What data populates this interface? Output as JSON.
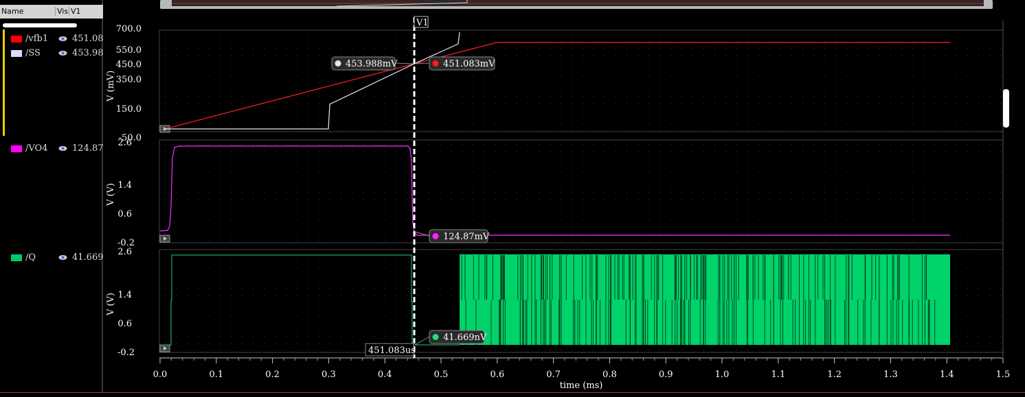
{
  "legend": {
    "headers": {
      "name": "Name",
      "vis": "Vis",
      "v1": "V1"
    },
    "signals": [
      {
        "name": "/vfb1",
        "value": "451.08",
        "color": "#ff0000"
      },
      {
        "name": "/SS",
        "value": "453.98",
        "color": "#d8dcff"
      },
      {
        "name": "/VO4",
        "value": "124.87",
        "color": "#ff00ff"
      },
      {
        "name": "/Q",
        "value": "41.669",
        "color": "#00cc66"
      }
    ]
  },
  "cursor": {
    "label": "V1",
    "time_label": "451.083us"
  },
  "markers": {
    "ss": "453.988mV",
    "vfb1": "451.083mV",
    "vo4": "124.87mV",
    "q": "41.669nV"
  },
  "panels": [
    {
      "ylabel": "V (mV)",
      "ticks": [
        "700.0",
        "550.0",
        "450.0",
        "350.0",
        "150.0",
        "-50.0"
      ]
    },
    {
      "ylabel": "V (V)",
      "ticks": [
        "2.6",
        "1.4",
        "0.6",
        "-0.2"
      ]
    },
    {
      "ylabel": "V (V)",
      "ticks": [
        "2.6",
        "1.4",
        "0.6",
        "-0.2"
      ]
    }
  ],
  "xaxis": {
    "label": "time (ms)",
    "ticks": [
      "0.0",
      "0.1",
      "0.2",
      "0.3",
      "0.4",
      "0.5",
      "0.6",
      "0.7",
      "0.8",
      "0.9",
      "1.0",
      "1.1",
      "1.2",
      "1.3",
      "1.4",
      "1.5"
    ]
  },
  "chart_data": [
    {
      "type": "line",
      "ylabel": "V (mV)",
      "series": [
        {
          "name": "/vfb1",
          "x": [
            0.0,
            0.45,
            0.6,
            1.407
          ],
          "y": [
            -50,
            451,
            610,
            610
          ]
        },
        {
          "name": "/SS",
          "x": [
            0.0,
            0.3,
            0.3,
            0.451,
            0.53,
            0.53
          ],
          "y": [
            -50,
            -50,
            170,
            454,
            580,
            640
          ]
        }
      ]
    },
    {
      "type": "line",
      "ylabel": "V (V)",
      "series": [
        {
          "name": "/VO4",
          "x": [
            0.0,
            0.02,
            0.025,
            0.44,
            0.45,
            0.46,
            1.407
          ],
          "y": [
            0.0,
            0.2,
            2.4,
            2.4,
            0.8,
            0.125,
            0.125
          ]
        }
      ]
    },
    {
      "type": "line",
      "ylabel": "V (V)",
      "series": [
        {
          "name": "/Q",
          "x": [
            0.0,
            0.02,
            0.021,
            0.45,
            0.451,
            0.535,
            1.407
          ],
          "y": [
            0.0,
            0.0,
            2.5,
            2.5,
            0.0,
            0.0,
            2.5
          ]
        }
      ]
    }
  ]
}
